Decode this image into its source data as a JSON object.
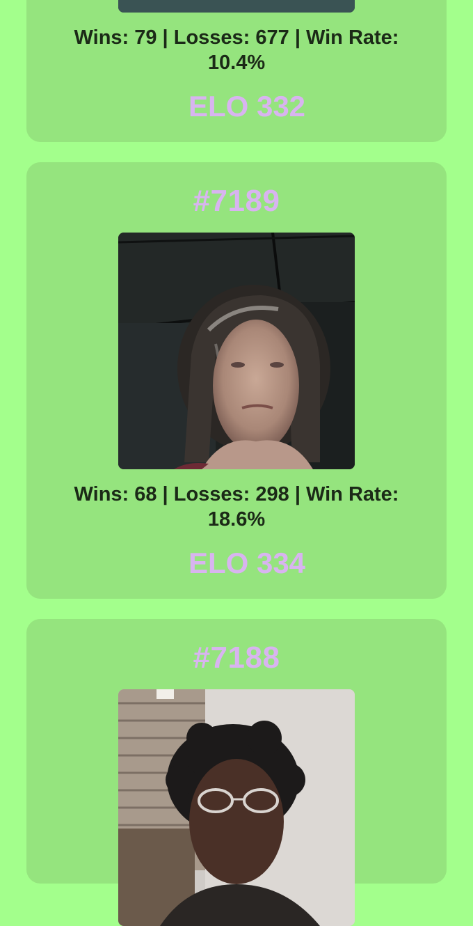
{
  "entries": [
    {
      "rank": "",
      "stats": "Wins: 79 | Losses: 677 | Win Rate: 10.4%",
      "wins": 79,
      "losses": 677,
      "win_rate": "10.4%",
      "elo": "ELO 332"
    },
    {
      "rank": "#7189",
      "stats": "Wins: 68 | Losses: 298 | Win Rate: 18.6%",
      "wins": 68,
      "losses": 298,
      "win_rate": "18.6%",
      "elo": "ELO 334"
    },
    {
      "rank": "#7188",
      "stats": "",
      "elo": ""
    }
  ],
  "colors": {
    "page_background": "#a3ff8c",
    "card_background": "#95e47e",
    "accent_lavender": "#d8b4f0",
    "stats_text": "#1b2a17"
  }
}
